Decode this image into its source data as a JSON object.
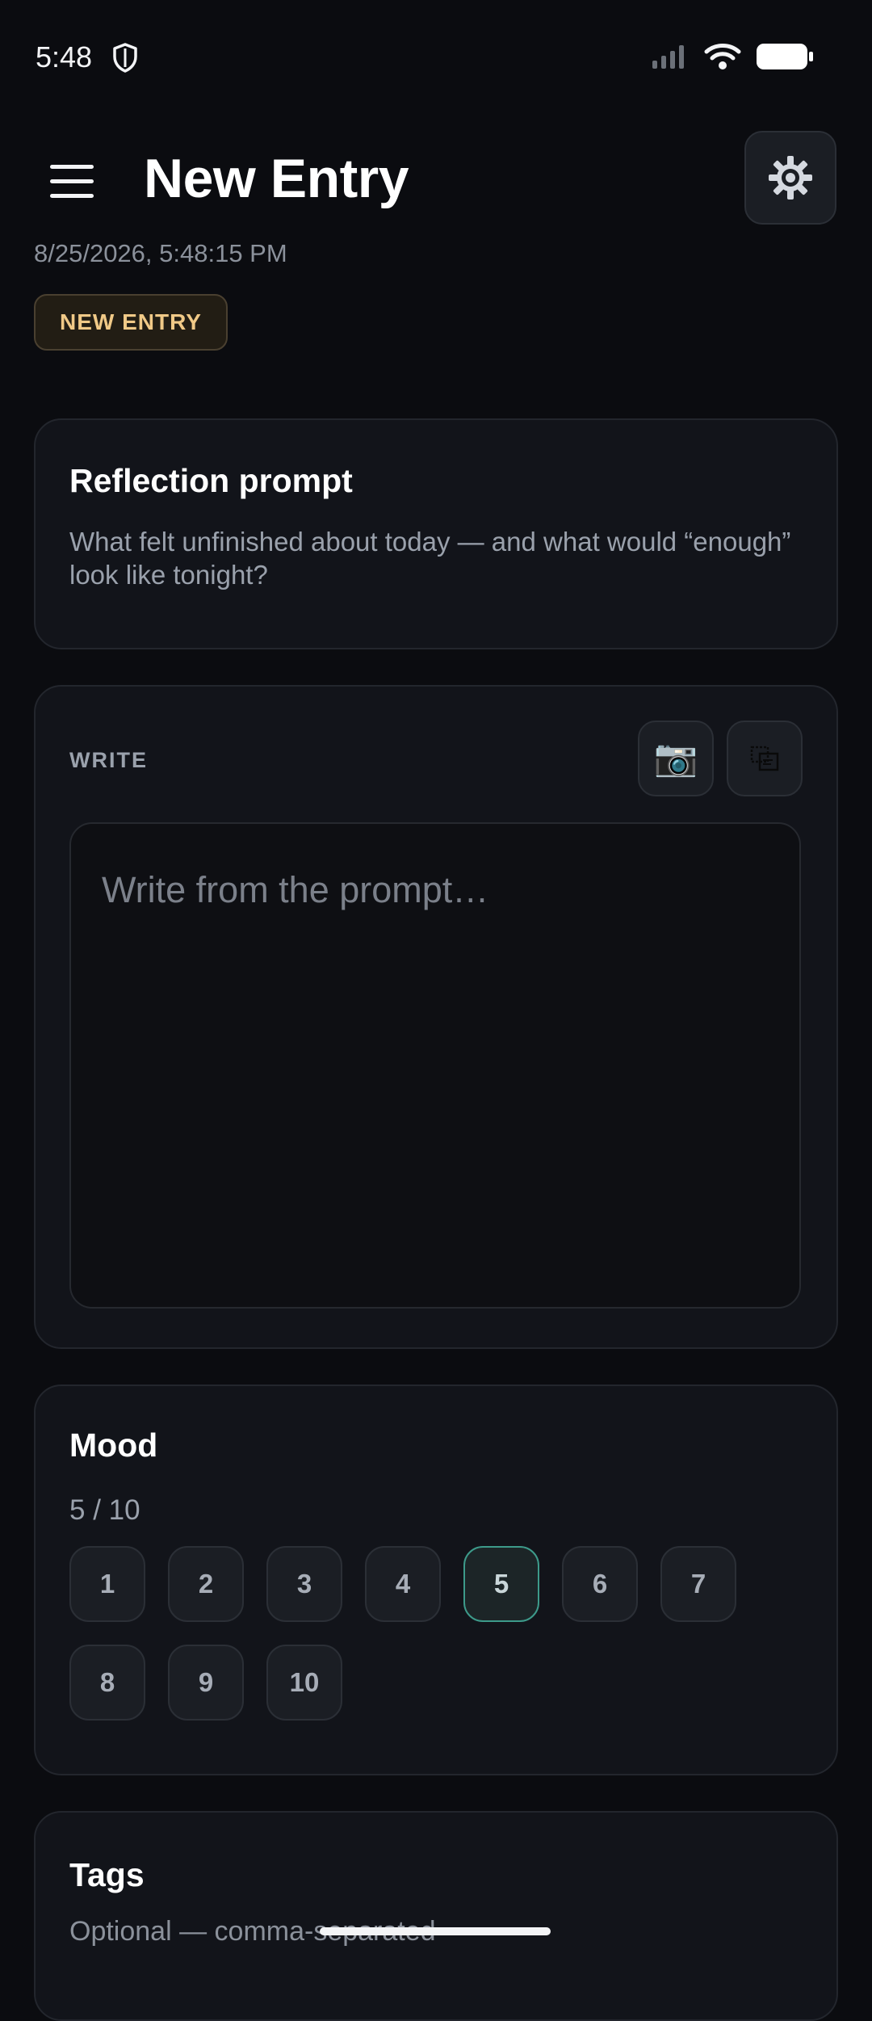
{
  "status_bar": {
    "time": "5:48"
  },
  "header": {
    "title": "New Entry",
    "timestamp": "8/25/2026, 5:48:15 PM",
    "badge": "NEW ENTRY"
  },
  "prompt": {
    "title": "Reflection prompt",
    "text": "What felt unfinished about today — and what would “enough” look like tonight?"
  },
  "write": {
    "label": "WRITE",
    "placeholder": "Write from the prompt…",
    "camera_icon": "📷",
    "paste_icon": "⎘"
  },
  "mood": {
    "title": "Mood",
    "value_text": "5 / 10",
    "selected": 5,
    "options": [
      "1",
      "2",
      "3",
      "4",
      "5",
      "6",
      "7",
      "8",
      "9",
      "10"
    ]
  },
  "tags": {
    "title": "Tags",
    "hint": "Optional — comma-separated"
  },
  "colors": {
    "background": "#0b0c10",
    "card": "#12141a",
    "badge_text": "#f0c987",
    "accent": "#3d9a8a"
  }
}
